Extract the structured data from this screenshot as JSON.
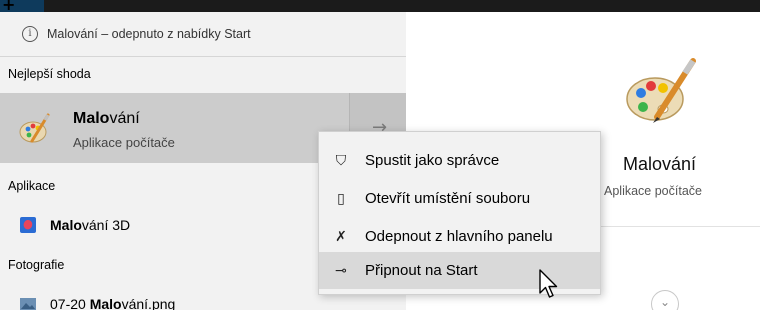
{
  "notice": {
    "text": "Malování – odepnuto z nabídky Start",
    "icon": "info-icon"
  },
  "sections": {
    "best_match": "Nejlepší shoda",
    "apps": "Aplikace",
    "photos": "Fotografie"
  },
  "best_match": {
    "title_bold": "Malo",
    "title_rest": "vání",
    "subtitle": "Aplikace počítače",
    "arrow": "→"
  },
  "apps": [
    {
      "title_bold": "Malo",
      "title_rest": "vání 3D",
      "icon": "paint-3d-icon"
    }
  ],
  "photos": [
    {
      "title_prefix": "07-20 ",
      "title_bold": "Malo",
      "title_rest": "vání.png",
      "icon": "image-file-icon"
    }
  ],
  "right_pane": {
    "title": "Malování",
    "subtitle": "Aplikace počítače",
    "expand": "⌄"
  },
  "context_menu": {
    "items": [
      {
        "label": "Spustit jako správce",
        "icon": "run-as-admin-icon",
        "glyph": "⛉"
      },
      {
        "label": "Otevřít umístění souboru",
        "icon": "open-folder-icon",
        "glyph": "▯"
      },
      {
        "label": "Odepnout z hlavního panelu",
        "icon": "unpin-icon",
        "glyph": "✗"
      },
      {
        "label": "Připnout na Start",
        "icon": "pin-icon",
        "glyph": "⊸"
      }
    ],
    "hovered_index": 3
  },
  "colors": {
    "left_pane_bg": "#f2f2f2",
    "selected_bg": "#cccccc",
    "menu_bg": "#f2f2f2",
    "menu_hover": "#d9d9d9"
  }
}
